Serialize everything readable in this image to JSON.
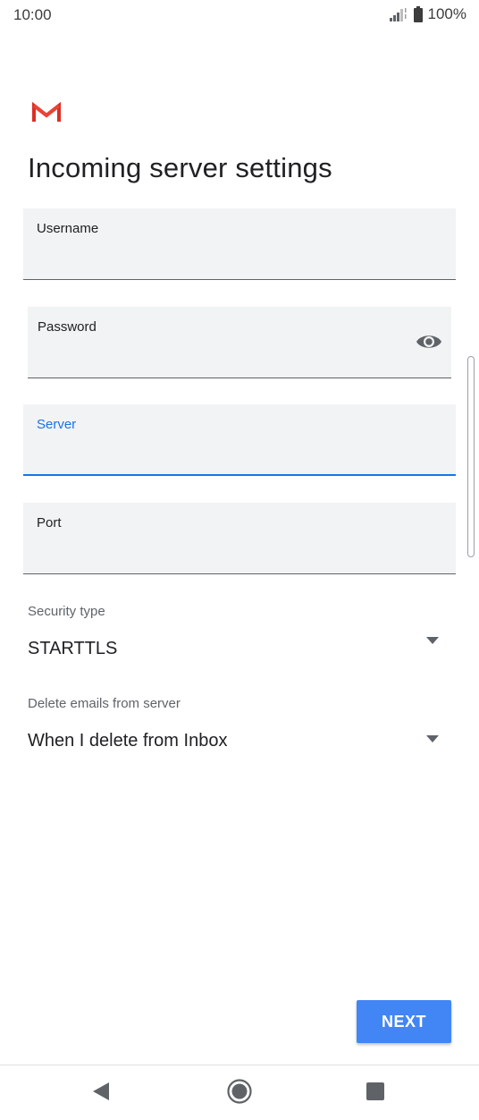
{
  "status_bar": {
    "time": "10:00",
    "battery_percent": "100%",
    "signal_icon": "signal-icon",
    "battery_icon": "battery-icon"
  },
  "app": {
    "logo_icon": "gmail-logo",
    "title": "Incoming server settings",
    "brand_color": "#d93025"
  },
  "form": {
    "username": {
      "label": "Username",
      "value": ""
    },
    "password": {
      "label": "Password",
      "value": "",
      "toggle_icon": "eye-icon"
    },
    "server": {
      "label": "Server",
      "value": "",
      "focused": true
    },
    "port": {
      "label": "Port",
      "value": ""
    },
    "security_type": {
      "label": "Security type",
      "value": "STARTTLS"
    },
    "delete_emails": {
      "label": "Delete emails from server",
      "value": "When I delete from Inbox"
    }
  },
  "actions": {
    "next_label": "NEXT",
    "accent_color": "#4285f4"
  },
  "nav": {
    "back_icon": "back-icon",
    "home_icon": "home-icon",
    "recents_icon": "recents-icon"
  }
}
